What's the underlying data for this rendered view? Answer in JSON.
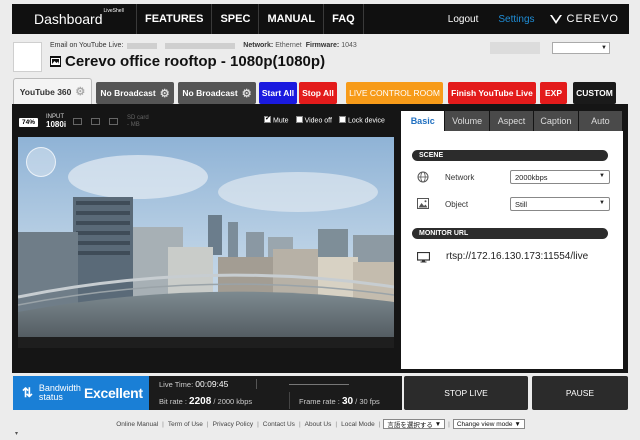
{
  "topnav": {
    "brand": "Dashboard",
    "brand_sup": "LiveShell",
    "items": [
      "FEATURES",
      "SPEC",
      "MANUAL",
      "FAQ"
    ],
    "logout": "Logout",
    "settings": "Settings",
    "logo_text": "CEREVO"
  },
  "info": {
    "email_label": "Email on YouTube Live:",
    "network_label": "Network:",
    "network_value": "Ethernet",
    "firmware_label": "Firmware:",
    "firmware_value": "1043",
    "title": "Cerevo office rooftop - 1080p(1080p)"
  },
  "tabs": {
    "youtube360": "YouTube 360",
    "nb1": "No Broadcast",
    "nb2": "No Broadcast"
  },
  "actions": {
    "start_all": "Start All",
    "stop_all": "Stop All",
    "live_control_room": "LIVE CONTROL ROOM",
    "finish_youtube_live": "Finish YouTube Live",
    "exp": "EXP",
    "custom": "CUSTOM"
  },
  "status": {
    "battery": "74%",
    "input_label": "INPUT",
    "input_value": "1080i",
    "sd_label": "SD card",
    "sd_value": "- MB"
  },
  "checks": {
    "mute": "Mute",
    "video_off": "Video off",
    "lock_device": "Lock device"
  },
  "side_tabs": [
    "Basic",
    "Volume",
    "Aspect",
    "Caption",
    "Auto"
  ],
  "scene": {
    "header": "SCENE",
    "network_label": "Network",
    "network_value": "2000kbps",
    "object_label": "Object",
    "object_value": "Still"
  },
  "monitor": {
    "header": "MONITOR URL",
    "url": "rtsp://172.16.130.173:11554/live"
  },
  "bandwidth": {
    "label_line1": "Bandwidth",
    "label_line2": "status",
    "quality": "Excellent"
  },
  "stats": {
    "live_time_label": "Live Time:",
    "live_time": "00:09:45",
    "bitrate_label": "Bit rate :",
    "bitrate": "2208",
    "bitrate_max": "/ 2000 kbps",
    "framerate_label": "Frame rate :",
    "framerate": "30",
    "framerate_max": "/ 30 fps"
  },
  "controls": {
    "stop_live": "STOP LIVE",
    "pause": "PAUSE"
  },
  "footer": {
    "links": [
      "Online Manual",
      "Term of Use",
      "Privacy Policy",
      "Contact Us",
      "About Us",
      "Local Mode"
    ],
    "language_select": "言語を選択する",
    "view_mode_select": "Change view mode"
  },
  "colors": {
    "accent_blue": "#1f8dd6",
    "bandwidth_blue": "#1a7fd6",
    "start_blue": "#1a1adf",
    "stop_red": "#e31b1b",
    "live_orange": "#f79b19",
    "panel_dark": "#151515"
  }
}
